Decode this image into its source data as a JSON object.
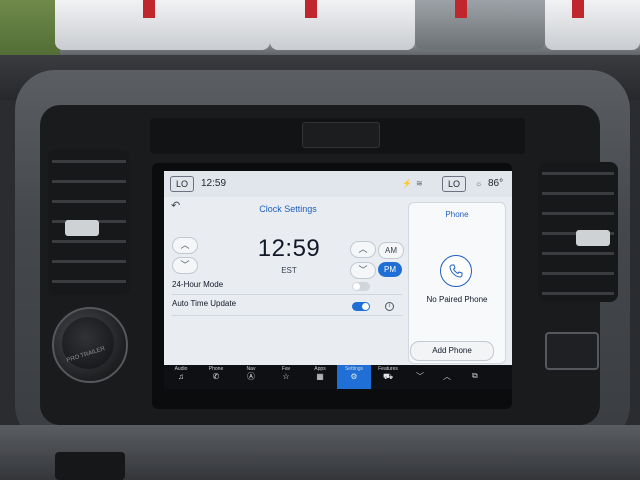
{
  "status_bar": {
    "left_pill": "LO",
    "clock": "12:59",
    "right_pill": "LO",
    "temperature": "86°"
  },
  "clock_settings": {
    "title": "Clock Settings",
    "time": "12:59",
    "timezone": "EST",
    "am_label": "AM",
    "pm_label": "PM",
    "selected_period": "PM",
    "hour_mode_label": "24-Hour Mode",
    "hour_mode_enabled": false,
    "auto_time_label": "Auto Time Update",
    "auto_time_enabled": true
  },
  "phone_panel": {
    "title": "Phone",
    "status": "No Paired Phone",
    "add_button": "Add Phone"
  },
  "nav_bar": {
    "items": [
      {
        "label": "Audio",
        "icon": "music-icon"
      },
      {
        "label": "Phone",
        "icon": "phone-icon"
      },
      {
        "label": "Nav",
        "icon": "navigation-icon"
      },
      {
        "label": "Fav",
        "icon": "star-icon"
      },
      {
        "label": "Apps",
        "icon": "grid-icon"
      },
      {
        "label": "Settings",
        "icon": "gear-icon"
      },
      {
        "label": "Features",
        "icon": "car-icon"
      }
    ],
    "active": "Settings"
  },
  "dashboard": {
    "dial_label": "PRO TRAILER"
  },
  "colors": {
    "accent": "#1f6fd6",
    "screen_bg": "#e9edf2",
    "title_blue": "#1f5fbf"
  }
}
